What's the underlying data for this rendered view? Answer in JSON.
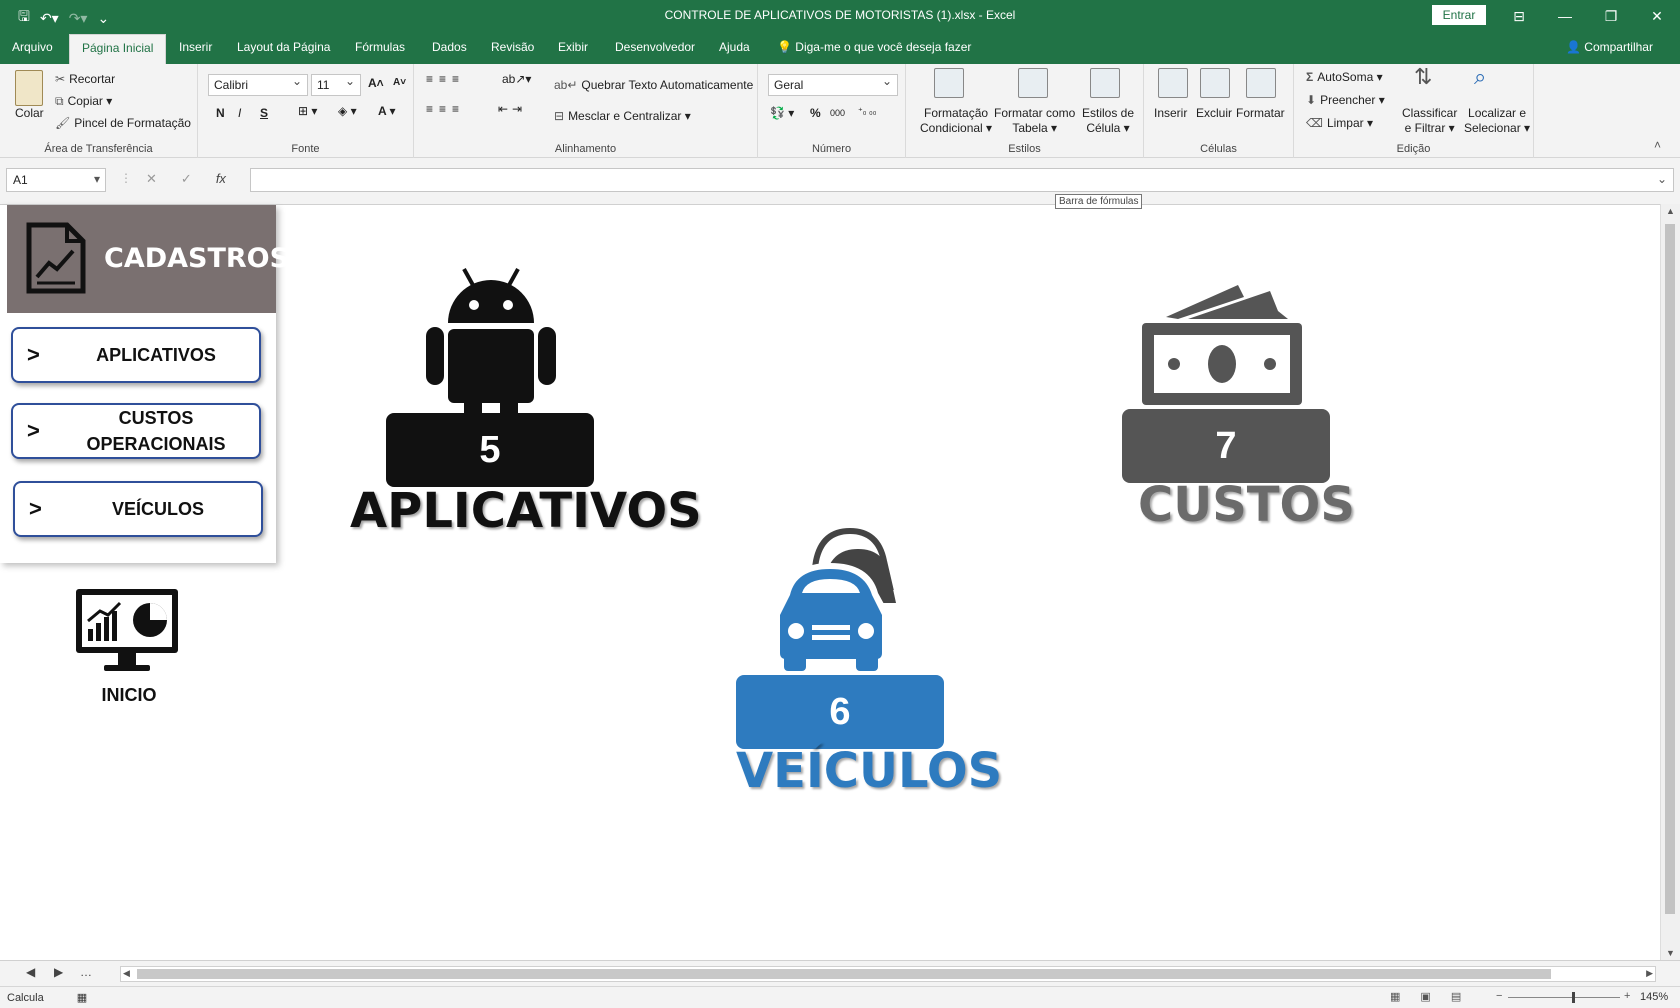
{
  "window": {
    "title": "CONTROLE DE APLICATIVOS DE MOTORISTAS (1).xlsx  -  Excel",
    "signin_label": "Entrar"
  },
  "tabs": [
    "Arquivo",
    "Página Inicial",
    "Inserir",
    "Layout da Página",
    "Fórmulas",
    "Dados",
    "Revisão",
    "Exibir",
    "Desenvolvedor",
    "Ajuda"
  ],
  "tell_me": "Diga-me o que você deseja fazer",
  "share_label": "Compartilhar",
  "ribbon": {
    "clipboard": {
      "label": "Área de Transferência",
      "paste": "Colar",
      "cut": "Recortar",
      "copy": "Copiar",
      "format_painter": "Pincel de Formatação"
    },
    "font": {
      "label": "Fonte",
      "name": "Calibri",
      "size": "11",
      "bold": "N",
      "italic": "I",
      "underline": "S"
    },
    "alignment": {
      "label": "Alinhamento",
      "wrap": "Quebrar Texto Automaticamente",
      "merge": "Mesclar e Centralizar"
    },
    "number": {
      "label": "Número",
      "format": "Geral"
    },
    "styles": {
      "label": "Estilos",
      "conditional": [
        "Formatação",
        "Condicional"
      ],
      "as_table": [
        "Formatar como",
        "Tabela"
      ],
      "cell_styles": [
        "Estilos de",
        "Célula"
      ]
    },
    "cells": {
      "label": "Células",
      "insert": "Inserir",
      "delete": "Excluir",
      "format": "Formatar"
    },
    "editing": {
      "label": "Edição",
      "autosum": "AutoSoma",
      "fill": "Preencher",
      "clear": "Limpar",
      "sort": [
        "Classificar",
        "e Filtrar"
      ],
      "find": [
        "Localizar e",
        "Selecionar"
      ]
    }
  },
  "formula_bar": {
    "name_box": "A1",
    "tooltip": "Barra de fórmulas"
  },
  "sheet": {
    "menu_title": "CADASTROS",
    "nav_buttons": [
      {
        "label": "APLICATIVOS"
      },
      {
        "label": "CUSTOS OPERACIONAIS"
      },
      {
        "label": "VEÍCULOS"
      }
    ],
    "home_label": "INICIO",
    "tiles": {
      "apps": {
        "value": "5",
        "label": "APLICATIVOS"
      },
      "costs": {
        "value": "7",
        "label": "CUSTOS"
      },
      "vehicles": {
        "value": "6",
        "label": "VEÍCULOS"
      }
    }
  },
  "status": {
    "mode": "Calcula",
    "zoom": "145%"
  },
  "colors": {
    "excel_green": "#217346",
    "apps_dark": "#111111",
    "costs_gray": "#555555",
    "vehicles_blue": "#2e7bbf",
    "card_header": "#7a7070"
  }
}
